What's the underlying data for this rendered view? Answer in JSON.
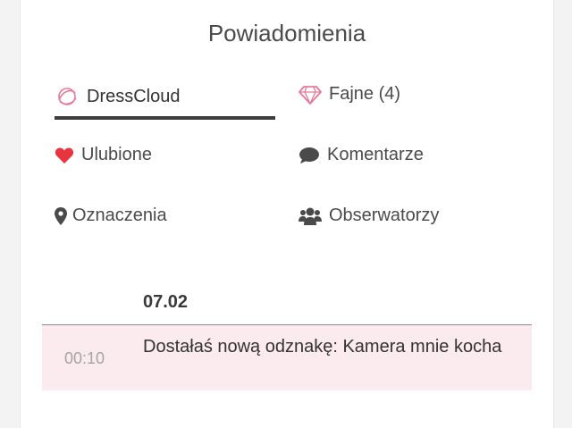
{
  "header": {
    "title": "Powiadomienia"
  },
  "tabs": [
    {
      "label": "DressCloud",
      "icon": "dresscloud-logo-icon",
      "active": true
    },
    {
      "label": "Fajne (4)",
      "icon": "diamond-icon"
    },
    {
      "label": "Ulubione",
      "icon": "heart-icon"
    },
    {
      "label": "Komentarze",
      "icon": "comment-icon"
    },
    {
      "label": "Oznaczenia",
      "icon": "location-pin-icon"
    },
    {
      "label": "Obserwatorzy",
      "icon": "users-icon"
    }
  ],
  "notifications": {
    "date": "07.02",
    "items": [
      {
        "time": "00:10",
        "message": "Dostałaś nową odznakę: Kamera mnie kocha"
      }
    ]
  },
  "colors": {
    "accent_pink": "#e8799a",
    "heart_red": "#e8343f",
    "notification_bg": "#fbeaee"
  }
}
